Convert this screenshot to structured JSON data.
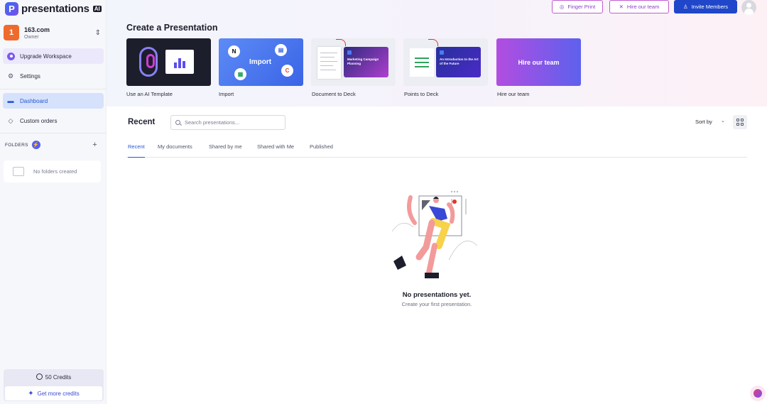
{
  "brand": {
    "name": "presentations",
    "suffix": "AI",
    "mark": "P"
  },
  "workspace": {
    "initial": "1",
    "name": "163.com",
    "role": "Owner"
  },
  "sidebar": {
    "upgrade_label": "Upgrade Workspace",
    "settings_label": "Settings",
    "dashboard_label": "Dashboard",
    "custom_orders_label": "Custom orders",
    "folders_label": "FOLDERS",
    "no_folders": "No folders created",
    "credits": "50 Credits",
    "get_more": "Get more credits"
  },
  "topbar": {
    "finger_print": "Finger Print",
    "hire_team": "Hire our team",
    "invite_members": "Invite Members"
  },
  "create": {
    "title": "Create a Presentation",
    "cards": [
      {
        "label": "Use an AI Template"
      },
      {
        "label": "Import",
        "inner": "Import"
      },
      {
        "label": "Document to Deck",
        "slide_title": "Marketing Campaign Planning"
      },
      {
        "label": "Points to Deck",
        "slide_title": "An Introduction to the Art of the Future"
      },
      {
        "label": "Hire our team",
        "inner": "Hire our team"
      }
    ]
  },
  "recent": {
    "title": "Recent",
    "search_placeholder": "Search presentations...",
    "sort_label": "Sort by",
    "tabs": [
      "Recent",
      "My documents",
      "Shared by me",
      "Shared with Me",
      "Published"
    ],
    "active_tab": "Recent",
    "empty_title": "No presentations yet.",
    "empty_subtitle": "Create your first presentation."
  },
  "colors": {
    "accent": "#2658d6",
    "brand_purple": "#7a5af0",
    "workspace_orange": "#ee6b2d"
  }
}
